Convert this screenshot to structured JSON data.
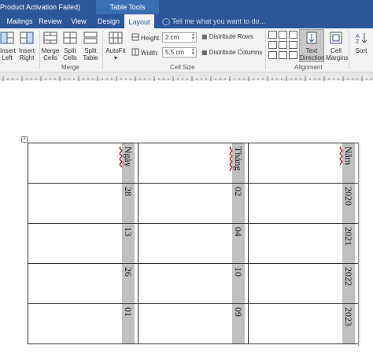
{
  "titlebar": {
    "app_title": "Product Activation Failed)",
    "context_group": "Table Tools"
  },
  "tabs": [
    {
      "label": "Mailings"
    },
    {
      "label": "Review"
    },
    {
      "label": "View"
    },
    {
      "label": "Design"
    },
    {
      "label": "Layout"
    }
  ],
  "tell_me": "Tell me what you want to do...",
  "ribbon": {
    "insert_left": "Insert Left",
    "insert_right": "Insert Right",
    "merge_cells": "Merge Cells",
    "split_cells": "Split Cells",
    "split_table": "Split Table",
    "autofit": "AutoFit",
    "height_label": "Height:",
    "height_value": "2 cm",
    "width_label": "Width:",
    "width_value": "5,5 cm",
    "distribute_rows": "Distribute Rows",
    "distribute_columns": "Distribute Columns",
    "text_direction": "Text Direction",
    "cell_margins": "Cell Margins",
    "sort": "Sort",
    "group_merge": "Merge",
    "group_cell_size": "Cell Size",
    "group_alignment": "Alignment"
  },
  "table": {
    "rows": [
      [
        "Ngày",
        "Tháng",
        "Năm"
      ],
      [
        "28",
        "02",
        "2020"
      ],
      [
        "13",
        "04",
        "2021"
      ],
      [
        "26",
        "10",
        "2022"
      ],
      [
        "01",
        "09",
        "2023"
      ]
    ]
  },
  "colors": {
    "brand": "#2b579a",
    "highlight_strip": "#c0c0c0"
  }
}
